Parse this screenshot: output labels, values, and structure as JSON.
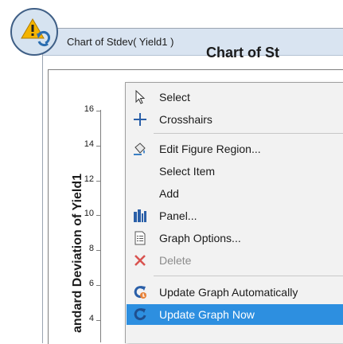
{
  "window": {
    "title": "Chart of Stdev( Yield1 )"
  },
  "chart": {
    "title_partial": "Chart of St",
    "ylabel_partial": "andard Deviation of Yield1",
    "y_ticks": [
      "16",
      "14",
      "12",
      "10",
      "8",
      "6",
      "4"
    ]
  },
  "context_menu": {
    "items": [
      {
        "label": "Select",
        "icon": "cursor-icon",
        "enabled": true
      },
      {
        "label": "Crosshairs",
        "icon": "crosshairs-icon",
        "enabled": true
      },
      {
        "label": "Edit Figure Region...",
        "icon": "paint-bucket-icon",
        "enabled": true
      },
      {
        "label": "Select Item",
        "icon": "",
        "enabled": true
      },
      {
        "label": "Add",
        "icon": "",
        "enabled": true
      },
      {
        "label": "Panel...",
        "icon": "panel-icon",
        "enabled": true
      },
      {
        "label": "Graph Options...",
        "icon": "document-icon",
        "enabled": true
      },
      {
        "label": "Delete",
        "icon": "delete-x-icon",
        "enabled": false
      },
      {
        "label": "Update Graph Automatically",
        "icon": "auto-update-icon",
        "enabled": true
      },
      {
        "label": "Update Graph Now",
        "icon": "update-now-icon",
        "enabled": true,
        "highlighted": true
      }
    ]
  },
  "colors": {
    "highlight": "#2d8fe0",
    "delete_red": "#d9534f",
    "titlebar": "#d9e4f1"
  }
}
